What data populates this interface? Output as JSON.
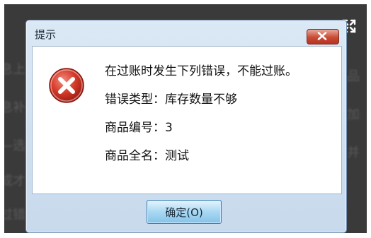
{
  "dialog": {
    "title": "提示",
    "lines": [
      "在过账时发生下列错误，不能过账。",
      "错误类型：库存数量不够",
      "商品编号：3",
      "商品全名：测试"
    ],
    "ok_label": "确定(O)",
    "icon": "error-icon"
  },
  "colors": {
    "title_bar": "#c7d9ec",
    "close_button": "#c94b36",
    "error_icon": "#c0392b",
    "ok_button": "#a9d8f3"
  }
}
